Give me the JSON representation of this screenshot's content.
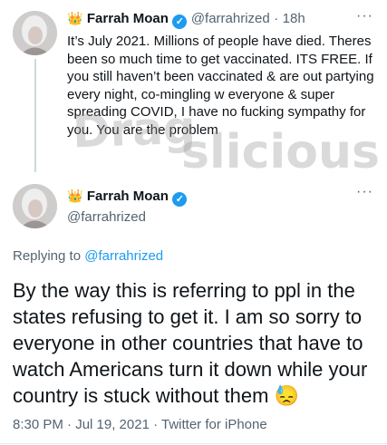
{
  "tweet1": {
    "crown_icon": "👑",
    "name": "Farrah Moan",
    "handle": "@farrahrized",
    "separator": "·",
    "time": "18h",
    "more_icon": "···",
    "text": "It’s July 2021. Millions of people have died. Theres been so much time to get vaccinated. ITS FREE. If you still haven’t been vaccinated & are out partying every night, co-mingling w everyone & super spreading COVID, I have no fucking sympathy for you. You are the problem"
  },
  "watermark": {
    "line1": "Drag",
    "line2": "slicious"
  },
  "tweet2": {
    "crown_icon": "👑",
    "name": "Farrah Moan",
    "handle": "@farrahrized",
    "more_icon": "···",
    "replying_prefix": "Replying to ",
    "replying_to": "@farrahrized",
    "text": "By the way this is referring to ppl in the states refusing to get it. I am so sorry to everyone in other countries that have to watch Americans turn it down while your country is stuck without them",
    "emoji": "😓",
    "timestamp": "8:30 PM · Jul 19, 2021 · Twitter for iPhone"
  },
  "colors": {
    "link": "#1d9bf0",
    "muted": "#536471",
    "verified": "#1d9bf0"
  }
}
